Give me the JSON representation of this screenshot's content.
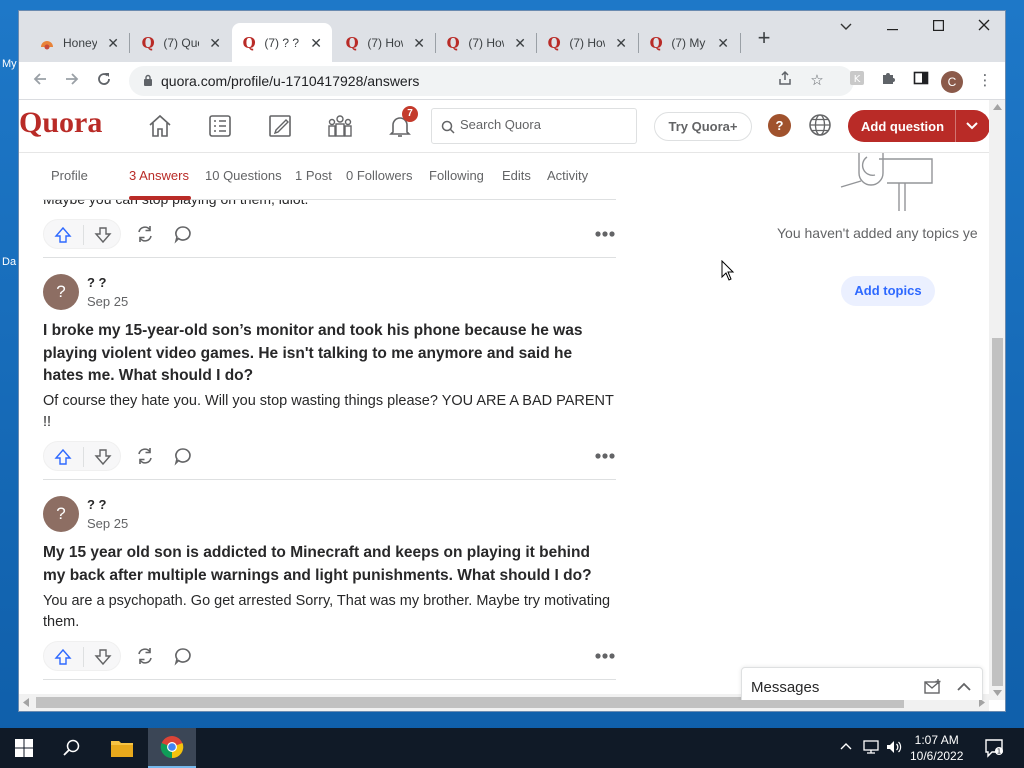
{
  "desktop": {
    "label_1": "My",
    "label_2": "Da"
  },
  "browser": {
    "tabs": [
      {
        "title": "Honey",
        "active": false
      },
      {
        "title": "(7) Quo",
        "active": false
      },
      {
        "title": "(7) ? ?",
        "active": true
      },
      {
        "title": "(7) How",
        "active": false
      },
      {
        "title": "(7) How",
        "active": false
      },
      {
        "title": "(7) How",
        "active": false
      },
      {
        "title": "(7) My",
        "active": false
      }
    ],
    "url": "quora.com/profile/u-1710417928/answers",
    "profile_initial": "C"
  },
  "quora": {
    "logo": "Quora",
    "notification_count": "7",
    "search_placeholder": "Search Quora",
    "try_plus": "Try Quora+",
    "help": "?",
    "add_question": "Add question"
  },
  "profile_tabs": [
    "Profile",
    "3 Answers",
    "10 Questions",
    "1 Post",
    "0 Followers",
    "Following",
    "Edits",
    "Activity"
  ],
  "feed": {
    "prev_answer_tail": "Maybe you can stop playing on them, idiot.",
    "posts": [
      {
        "avatar": "?",
        "author": "? ?",
        "date": "Sep 25",
        "question": "I broke my 15-year-old son’s monitor and took his phone because he was playing violent video games. He isn't talking to me anymore and said he hates me. What should I do?",
        "answer": "Of course they hate you. Will you stop wasting things please? YOU ARE A BAD PARENT !!"
      },
      {
        "avatar": "?",
        "author": "? ?",
        "date": "Sep 25",
        "question": "My 15 year old son is addicted to Minecraft and keeps on playing it behind my back after multiple warnings and light punishments. What should I do?",
        "answer": "You are a psychopath. Go get arrested Sorry, That was my brother. Maybe try motivating them."
      }
    ]
  },
  "sidebar": {
    "no_topics": "You haven't added any topics ye",
    "add_topics": "Add topics"
  },
  "messages": {
    "label": "Messages"
  },
  "taskbar": {
    "time": "1:07 AM",
    "date": "10/6/2022"
  }
}
